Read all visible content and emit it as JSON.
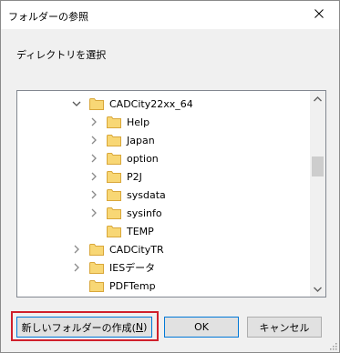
{
  "window": {
    "title": "フォルダーの参照"
  },
  "description": "ディレクトリを選択",
  "tree": {
    "items": [
      {
        "label": "CADCity22xx_64",
        "expanded": true
      },
      {
        "label": "Help"
      },
      {
        "label": "Japan"
      },
      {
        "label": "option"
      },
      {
        "label": "P2J"
      },
      {
        "label": "sysdata"
      },
      {
        "label": "sysinfo"
      },
      {
        "label": "TEMP"
      },
      {
        "label": "CADCityTR"
      },
      {
        "label": "IESデータ"
      },
      {
        "label": "PDFTemp"
      }
    ]
  },
  "buttons": {
    "new_folder": "新しいフォルダーの作成(",
    "new_folder_accel": "N",
    "new_folder_close": ")",
    "ok": "OK",
    "cancel": "キャンセル"
  },
  "icons": {
    "close": "close-icon",
    "chevron_down": "chevron-down-icon",
    "chevron_right": "chevron-right-icon",
    "folder": "folder-icon",
    "scroll_up": "scroll-up-arrow-icon",
    "scroll_down": "scroll-down-arrow-icon",
    "grip": "resize-grip-icon"
  },
  "colors": {
    "folder_fill": "#f8d775",
    "folder_stroke": "#d9a73a",
    "highlight_border": "#d0202c",
    "focus_border": "#0078d7"
  }
}
